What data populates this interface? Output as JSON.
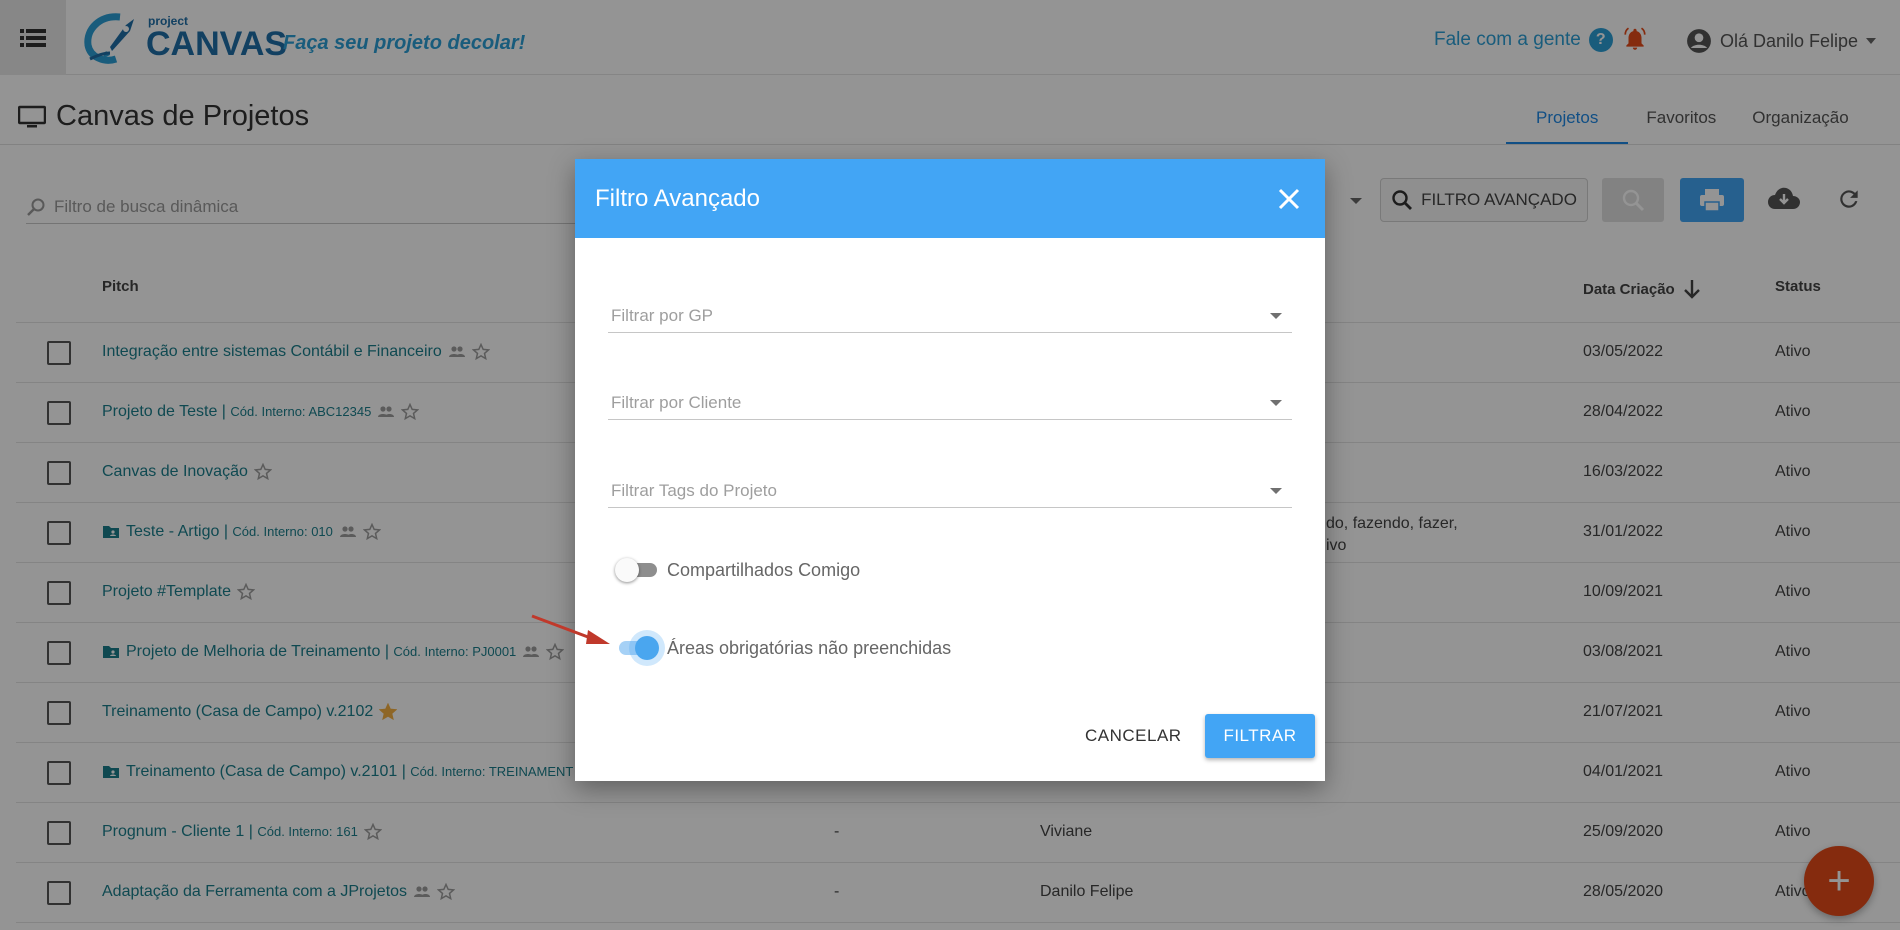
{
  "app": {
    "logo_small": "project",
    "logo_big": "CANVAS",
    "tagline": "Faça seu projeto decolar!",
    "contact_label": "Fale com a gente",
    "user_greeting": "Olá Danilo Felipe"
  },
  "page": {
    "title": "Canvas de Projetos",
    "tabs": [
      {
        "label": "Projetos",
        "active": true
      },
      {
        "label": "Favoritos",
        "active": false
      },
      {
        "label": "Organização",
        "active": false
      }
    ]
  },
  "toolbar": {
    "search_placeholder": "Filtro de busca dinâmica",
    "advanced_filter_label": "FILTRO AVANÇADO"
  },
  "table": {
    "headers": {
      "pitch": "Pitch",
      "date": "Data Criação",
      "status": "Status"
    },
    "rows": [
      {
        "pitch": "Integração entre sistemas Contábil e Financeiro",
        "code": "",
        "folder": false,
        "shared": true,
        "starred": false,
        "gp": "",
        "client": "",
        "tags": "",
        "date": "03/05/2022",
        "status": "Ativo"
      },
      {
        "pitch": "Projeto de Teste | ",
        "code": "Cód. Interno: ABC12345",
        "folder": false,
        "shared": true,
        "starred": false,
        "gp": "",
        "client": "",
        "tags": "",
        "date": "28/04/2022",
        "status": "Ativo"
      },
      {
        "pitch": "Canvas de Inovação",
        "code": "",
        "folder": false,
        "shared": false,
        "starred": false,
        "gp": "",
        "client": "",
        "tags": "",
        "date": "16/03/2022",
        "status": "Ativo"
      },
      {
        "pitch": "Teste - Artigo | ",
        "code": "Cód. Interno: 010",
        "folder": true,
        "shared": true,
        "starred": false,
        "gp": "",
        "client": "",
        "tags_line1": "do, fazendo, fazer,",
        "tags_line2": "ivo",
        "date": "31/01/2022",
        "status": "Ativo"
      },
      {
        "pitch": "Projeto #Template",
        "code": "",
        "folder": false,
        "shared": false,
        "starred": false,
        "gp": "",
        "client": "",
        "tags": "",
        "date": "10/09/2021",
        "status": "Ativo"
      },
      {
        "pitch": "Projeto de Melhoria de Treinamento | ",
        "code": "Cód. Interno: PJ0001",
        "folder": true,
        "shared": true,
        "starred": false,
        "gp": "",
        "client": "",
        "tags": "",
        "date": "03/08/2021",
        "status": "Ativo"
      },
      {
        "pitch": "Treinamento (Casa de Campo) v.2102",
        "code": "",
        "folder": false,
        "shared": false,
        "starred": true,
        "gp": "",
        "client": "",
        "tags": "",
        "date": "21/07/2021",
        "status": "Ativo"
      },
      {
        "pitch": "Treinamento (Casa de Campo) v.2101 | ",
        "code": "Cód. Interno: TREINAMENT",
        "folder": true,
        "shared": false,
        "starred": false,
        "gp": "",
        "client": "",
        "tags": "",
        "date": "04/01/2021",
        "status": "Ativo"
      },
      {
        "pitch": "Prognum - Cliente 1 | ",
        "code": "Cód. Interno: 161",
        "folder": false,
        "shared": false,
        "starred": false,
        "gp": "-",
        "client": "Viviane",
        "tags": "",
        "date": "25/09/2020",
        "status": "Ativo"
      },
      {
        "pitch": "Adaptação da Ferramenta com a JProjetos",
        "code": "",
        "folder": false,
        "shared": true,
        "starred": false,
        "gp": "-",
        "client": "Danilo Felipe",
        "tags": "",
        "date": "28/05/2020",
        "status": "Ativo"
      }
    ]
  },
  "fab_label": "+",
  "modal": {
    "title": "Filtro Avançado",
    "fields": {
      "gp_placeholder": "Filtrar por GP",
      "client_placeholder": "Filtrar por Cliente",
      "tags_placeholder": "Filtrar Tags do Projeto"
    },
    "toggles": {
      "shared_label": "Compartilhados Comigo",
      "shared_on": false,
      "required_label": "Áreas obrigatórias não preenchidas",
      "required_on": true
    },
    "cancel_label": "CANCELAR",
    "filter_label": "FILTRAR"
  },
  "colors": {
    "primary": "#42a5f5",
    "brand": "#1f6fa8",
    "link": "#1b7f8c",
    "fab": "#e64a19",
    "bell": "#e64a19",
    "annotation_arrow": "#c0392b"
  }
}
